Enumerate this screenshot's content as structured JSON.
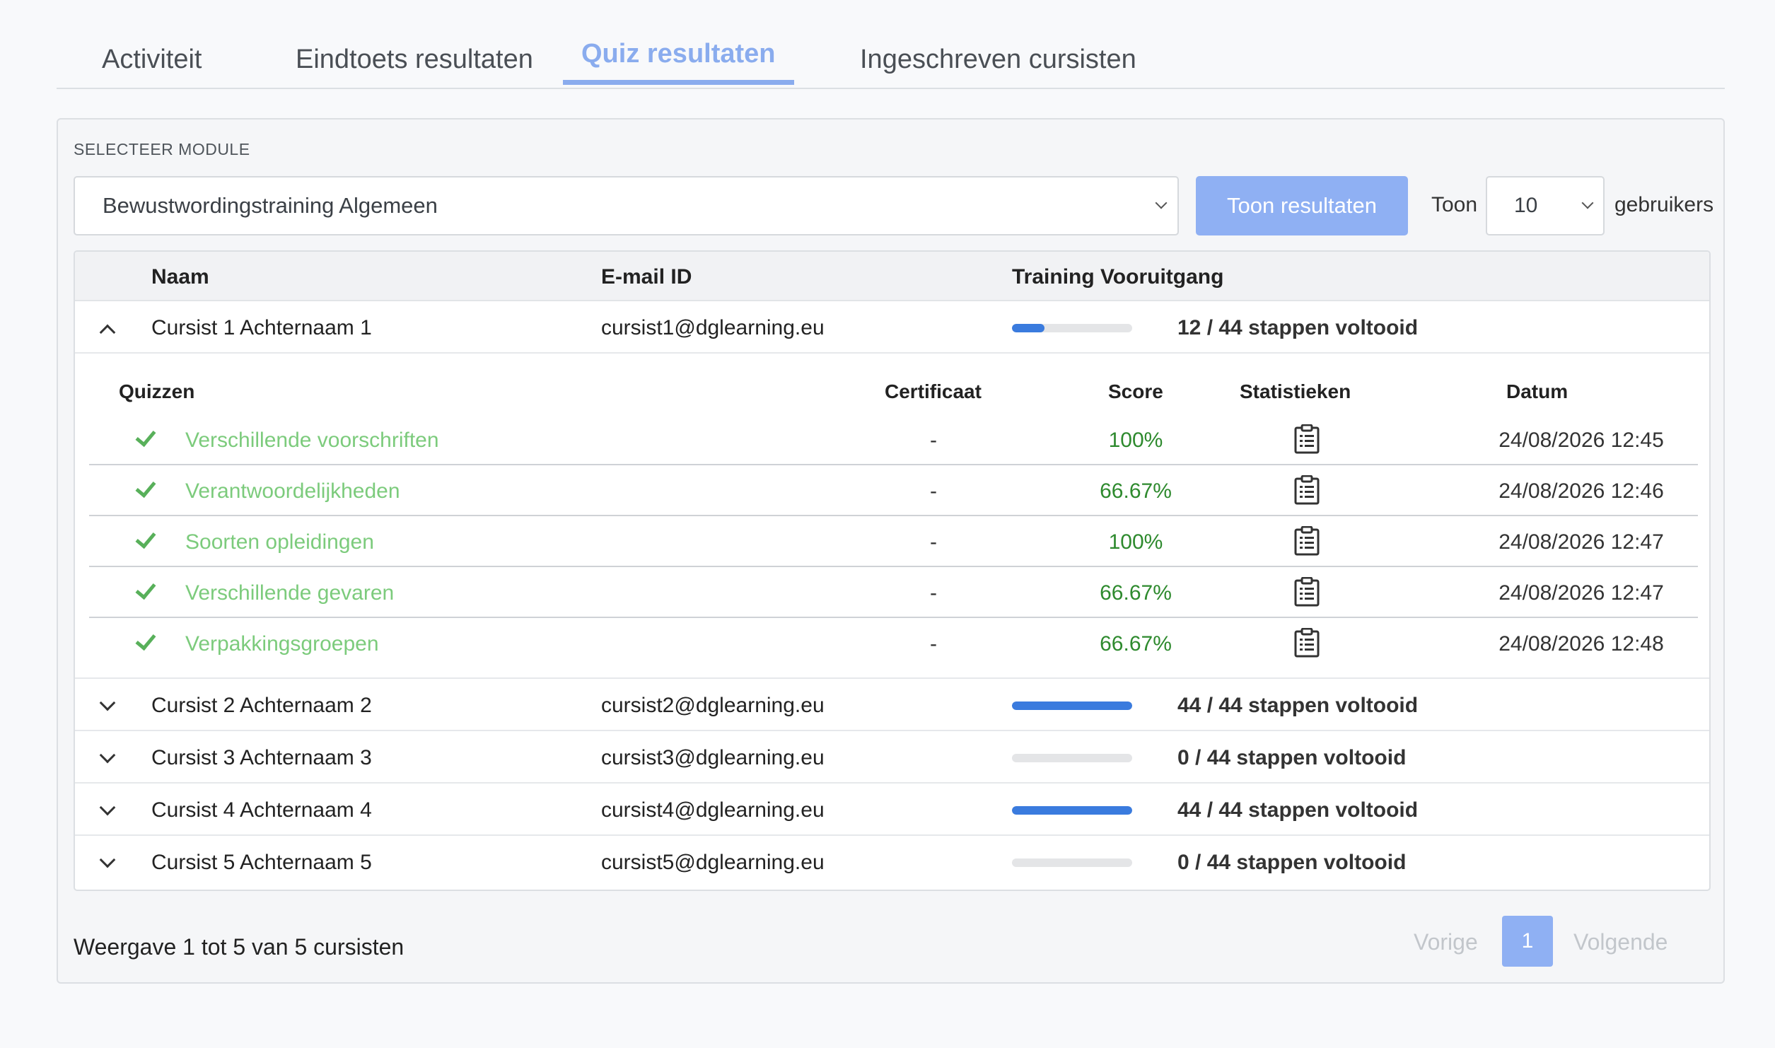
{
  "tabs": [
    {
      "label": "Activiteit",
      "active": false
    },
    {
      "label": "Eindtoets resultaten",
      "active": false
    },
    {
      "label": "Quiz resultaten",
      "active": true
    },
    {
      "label": "Ingeschreven cursisten",
      "active": false
    }
  ],
  "filters": {
    "module_label": "SELECTEER MODULE",
    "module_value": "Bewustwordingstraining Algemeen",
    "show_button": "Toon resultaten",
    "show_label": "Toon",
    "count_value": "10",
    "users_label": "gebruikers"
  },
  "table": {
    "headers": {
      "name": "Naam",
      "email": "E-mail ID",
      "progress": "Training Vooruitgang"
    },
    "rows": [
      {
        "name": "Cursist 1 Achternaam 1",
        "email": "cursist1@dglearning.eu",
        "progress_text": "12 / 44 stappen voltooid",
        "progress_fraction": 0.2727,
        "expanded": true
      },
      {
        "name": "Cursist 2 Achternaam 2",
        "email": "cursist2@dglearning.eu",
        "progress_text": "44 / 44 stappen voltooid",
        "progress_fraction": 1.0,
        "expanded": false
      },
      {
        "name": "Cursist 3 Achternaam 3",
        "email": "cursist3@dglearning.eu",
        "progress_text": "0 / 44 stappen voltooid",
        "progress_fraction": 0.0,
        "expanded": false
      },
      {
        "name": "Cursist 4 Achternaam 4",
        "email": "cursist4@dglearning.eu",
        "progress_text": "44 / 44 stappen voltooid",
        "progress_fraction": 1.0,
        "expanded": false
      },
      {
        "name": "Cursist 5 Achternaam 5",
        "email": "cursist5@dglearning.eu",
        "progress_text": "0 / 44 stappen voltooid",
        "progress_fraction": 0.0,
        "expanded": false
      }
    ]
  },
  "quiz": {
    "headers": {
      "quizzes": "Quizzen",
      "certificate": "Certificaat",
      "score": "Score",
      "stats": "Statistieken",
      "date": "Datum"
    },
    "rows": [
      {
        "name": "Verschillende voorschriften",
        "certificate": "-",
        "score": "100%",
        "date": "24/08/2026 12:45"
      },
      {
        "name": "Verantwoordelijkheden",
        "certificate": "-",
        "score": "66.67%",
        "date": "24/08/2026 12:46"
      },
      {
        "name": "Soorten opleidingen",
        "certificate": "-",
        "score": "100%",
        "date": "24/08/2026 12:47"
      },
      {
        "name": "Verschillende gevaren",
        "certificate": "-",
        "score": "66.67%",
        "date": "24/08/2026 12:47"
      },
      {
        "name": "Verpakkingsgroepen",
        "certificate": "-",
        "score": "66.67%",
        "date": "24/08/2026 12:48"
      }
    ]
  },
  "footer": {
    "info": "Weergave 1 tot 5 van 5 cursisten",
    "prev": "Vorige",
    "page": "1",
    "next": "Volgende"
  },
  "colors": {
    "accent": "#8aacee",
    "progress_fill": "#3a7bde",
    "quiz_link": "#7ccb7c",
    "score": "#2e8a2e"
  },
  "icons": {
    "quiz_passed": "check-icon",
    "statistics": "clipboard-list-icon",
    "expand": "chevron-down-icon",
    "collapse": "chevron-up-icon"
  }
}
